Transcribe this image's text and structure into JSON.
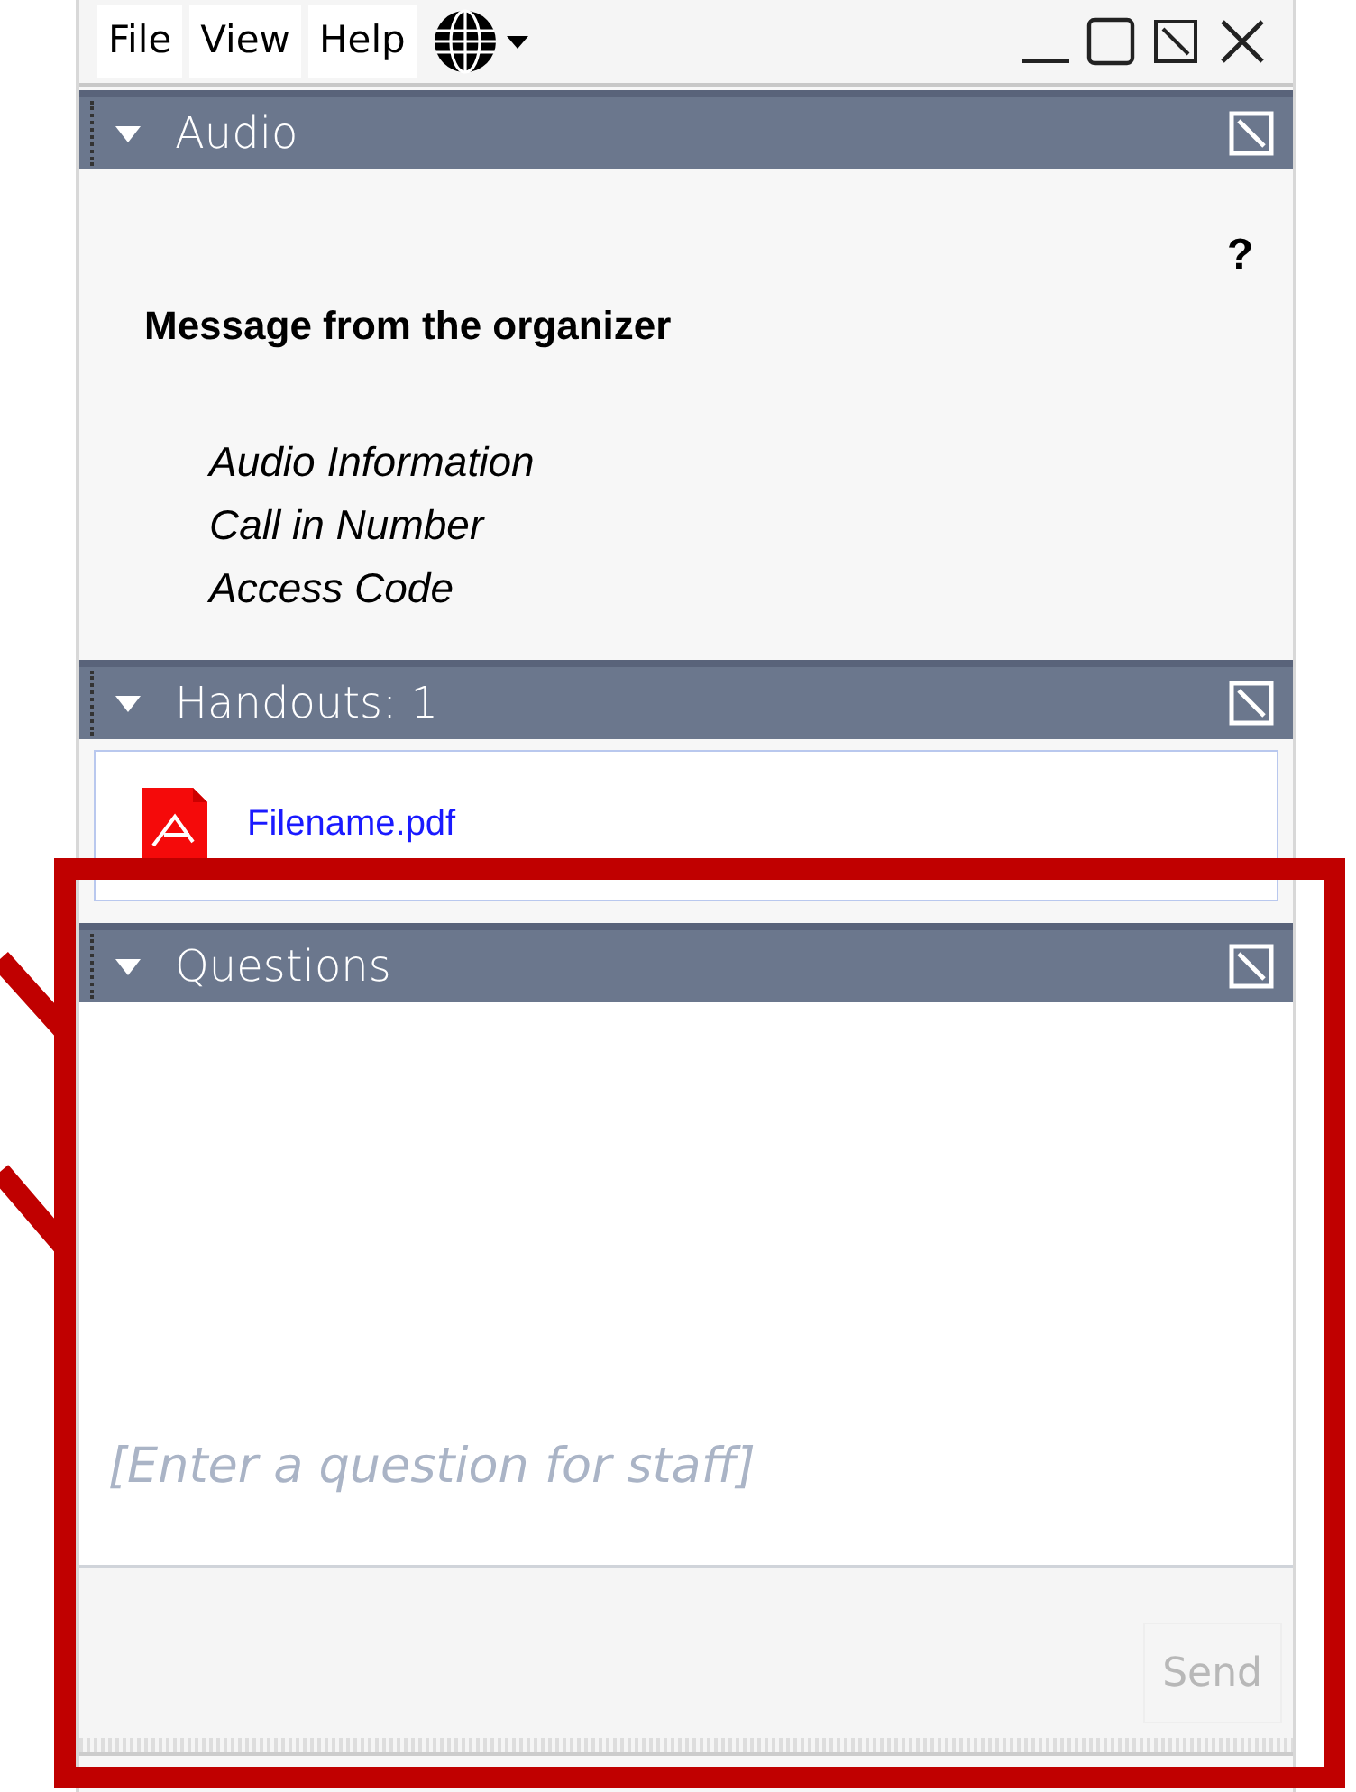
{
  "menu": [
    {
      "label": "File"
    },
    {
      "label": "View"
    },
    {
      "label": "Help"
    }
  ],
  "sections": [
    {
      "kind": "audio",
      "title": "Audio",
      "expanded": true,
      "help": "?",
      "heading": "Message from the organizer",
      "lines": [
        "Audio Information",
        "Call in Number",
        "Access Code"
      ]
    },
    {
      "kind": "handouts",
      "title": "Handouts: 1",
      "expanded": true,
      "files": [
        "Filename.pdf"
      ]
    },
    {
      "kind": "questions",
      "title": "Questions",
      "expanded": true,
      "placeholder": "[Enter a question for staff]",
      "send": {
        "label": "Send",
        "disabled": true
      }
    }
  ],
  "highlight": {
    "on": true
  }
}
